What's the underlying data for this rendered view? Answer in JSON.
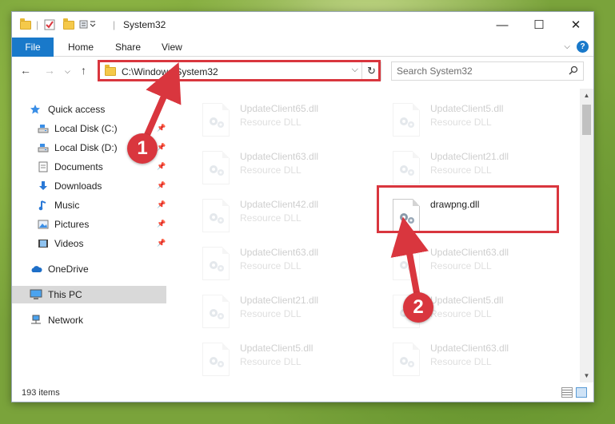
{
  "window": {
    "title": "System32",
    "minimize": "—",
    "maximize": "☐",
    "close": "✕"
  },
  "ribbon": {
    "tabs": [
      "File",
      "Home",
      "Share",
      "View"
    ],
    "help": "?"
  },
  "address_bar": {
    "path": "C:\\Windows\\System32",
    "dropdown": "⌵",
    "refresh": "↻"
  },
  "search": {
    "placeholder": "Search System32"
  },
  "sidebar": {
    "items": [
      {
        "label": "Quick access",
        "icon": "star-icon",
        "pinned": false,
        "indent": false
      },
      {
        "label": "Local Disk (C:)",
        "icon": "drive-icon",
        "pinned": true,
        "indent": true
      },
      {
        "label": "Local Disk (D:)",
        "icon": "drive-icon",
        "pinned": true,
        "indent": true
      },
      {
        "label": "Documents",
        "icon": "documents-icon",
        "pinned": true,
        "indent": true
      },
      {
        "label": "Downloads",
        "icon": "download-icon",
        "pinned": true,
        "indent": true
      },
      {
        "label": "Music",
        "icon": "music-icon",
        "pinned": true,
        "indent": true
      },
      {
        "label": "Pictures",
        "icon": "pictures-icon",
        "pinned": true,
        "indent": true
      },
      {
        "label": "Videos",
        "icon": "videos-icon",
        "pinned": true,
        "indent": true
      },
      {
        "label": "OneDrive",
        "icon": "cloud-icon",
        "pinned": false,
        "indent": false
      },
      {
        "label": "This PC",
        "icon": "computer-icon",
        "pinned": false,
        "indent": false,
        "selected": true
      },
      {
        "label": "Network",
        "icon": "network-icon",
        "pinned": false,
        "indent": false
      }
    ]
  },
  "files": {
    "left": [
      {
        "name": "UpdateClient65.dll",
        "type": "Resource DLL"
      },
      {
        "name": "UpdateClient63.dll",
        "type": "Resource DLL"
      },
      {
        "name": "UpdateClient42.dll",
        "type": "Resource DLL"
      },
      {
        "name": "UpdateClient63.dll",
        "type": "Resource DLL"
      },
      {
        "name": "UpdateClient21.dll",
        "type": "Resource DLL"
      },
      {
        "name": "UpdateClient5.dll",
        "type": "Resource DLL"
      }
    ],
    "right": [
      {
        "name": "UpdateClient5.dll",
        "type": "Resource DLL"
      },
      {
        "name": "UpdateClient21.dll",
        "type": "Resource DLL"
      },
      {
        "name": "drawpng.dll",
        "type": "",
        "highlighted": true
      },
      {
        "name": "UpdateClient63.dll",
        "type": "Resource DLL"
      },
      {
        "name": "UpdateClient5.dll",
        "type": "Resource DLL"
      },
      {
        "name": "UpdateClient63.dll",
        "type": "Resource DLL"
      }
    ]
  },
  "status": {
    "items_count": "193 items"
  },
  "annotations": {
    "step1": "1",
    "step2": "2",
    "color": "#d9363e"
  }
}
